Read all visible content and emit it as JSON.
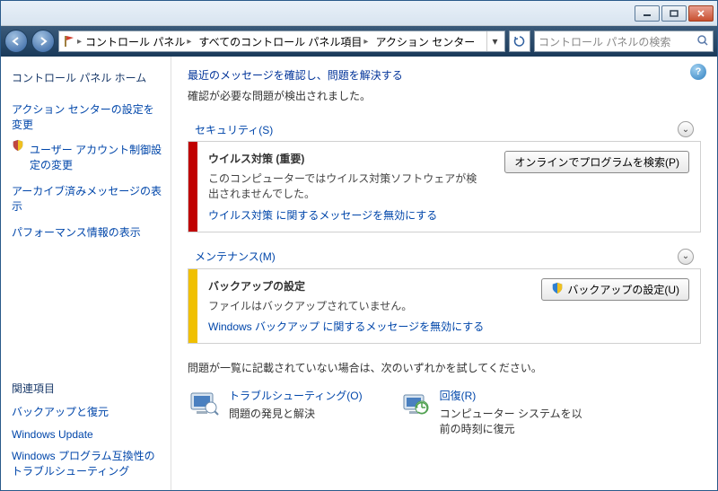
{
  "breadcrumb": {
    "items": [
      "コントロール パネル",
      "すべてのコントロール パネル項目",
      "アクション センター"
    ]
  },
  "search": {
    "placeholder": "コントロール パネルの検索"
  },
  "sidebar": {
    "home": "コントロール パネル ホーム",
    "links": [
      {
        "label": "アクション センターの設定を変更",
        "shield": false
      },
      {
        "label": "ユーザー アカウント制御設定の変更",
        "shield": true
      },
      {
        "label": "アーカイブ済みメッセージの表示",
        "shield": false
      },
      {
        "label": "パフォーマンス情報の表示",
        "shield": false
      }
    ],
    "related_heading": "関連項目",
    "related": [
      "バックアップと復元",
      "Windows Update",
      "Windows プログラム互換性のトラブルシューティング"
    ]
  },
  "main": {
    "title": "最近のメッセージを確認し、問題を解決する",
    "subtitle": "確認が必要な問題が検出されました。",
    "sections": [
      {
        "header": "セキュリティ(S)",
        "stripe": "red",
        "alert_title": "ウイルス対策 (重要)",
        "alert_desc": "このコンピューターではウイルス対策ソフトウェアが検出されませんでした。",
        "alert_link": "ウイルス対策 に関するメッセージを無効にする",
        "button": "オンラインでプログラムを検索(P)",
        "shield_button": false
      },
      {
        "header": "メンテナンス(M)",
        "stripe": "yellow",
        "alert_title": "バックアップの設定",
        "alert_desc": "ファイルはバックアップされていません。",
        "alert_link": "Windows バックアップ に関するメッセージを無効にする",
        "button": "バックアップの設定(U)",
        "shield_button": true
      }
    ],
    "footer_note": "問題が一覧に記載されていない場合は、次のいずれかを試してください。",
    "footer_links": [
      {
        "label": "トラブルシューティング(O)",
        "desc": "問題の発見と解決"
      },
      {
        "label": "回復(R)",
        "desc": "コンピューター システムを以前の時刻に復元"
      }
    ]
  }
}
